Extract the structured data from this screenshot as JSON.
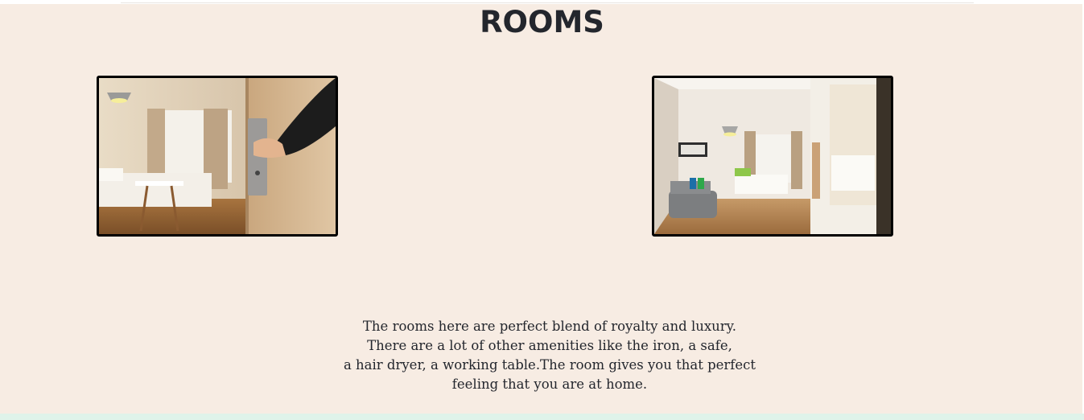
{
  "rooms": {
    "title": "ROOMS",
    "images": [
      {
        "name": "room-door-photo",
        "alt": "Hand opening hotel room door"
      },
      {
        "name": "room-interior-photo",
        "alt": "Hotel room interior with sofa and bed"
      }
    ],
    "description_lines": [
      "The rooms here are perfect blend of royalty and luxury.",
      "There are a lot of other amenities like the iron, a safe,",
      "a hair dryer, a working table.The room gives you that perfect",
      "feeling that you are at home."
    ]
  },
  "colors": {
    "section_bg": "#f7ece3",
    "footer_bg": "#dff3ea",
    "text": "#23262d",
    "photo_border": "#000000"
  }
}
